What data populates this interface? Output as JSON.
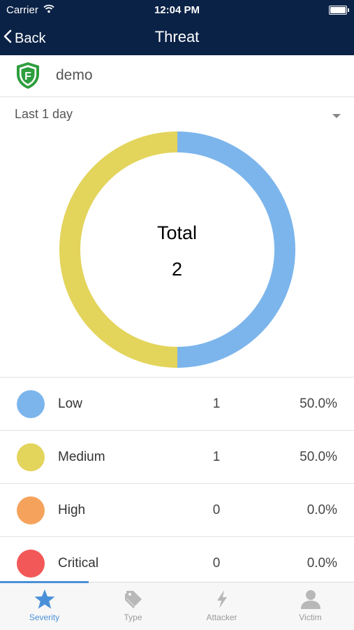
{
  "status": {
    "carrier": "Carrier",
    "time": "12:04 PM"
  },
  "nav": {
    "back_label": "Back",
    "title": "Threat"
  },
  "org": {
    "name": "demo",
    "logo_letter": "F",
    "logo_color": "#2e9e3f"
  },
  "range": {
    "selected": "Last 1 day"
  },
  "chart_data": {
    "type": "pie",
    "title": "",
    "center_label": "Total",
    "total": "2",
    "categories": [
      "Low",
      "Medium",
      "High",
      "Critical"
    ],
    "values": [
      1,
      1,
      0,
      0
    ],
    "colors": [
      "#7cb5ec",
      "#e3d45c",
      "#f5a35c",
      "#f25858"
    ],
    "donut": true
  },
  "legend": {
    "rows": [
      {
        "label": "Low",
        "count": "1",
        "percent": "50.0%",
        "color": "#7cb5ec"
      },
      {
        "label": "Medium",
        "count": "1",
        "percent": "50.0%",
        "color": "#e3d45c"
      },
      {
        "label": "High",
        "count": "0",
        "percent": "0.0%",
        "color": "#f5a35c"
      },
      {
        "label": "Critical",
        "count": "0",
        "percent": "0.0%",
        "color": "#f25858"
      }
    ]
  },
  "tabs": [
    {
      "label": "Severity",
      "icon": "star-icon",
      "active": true
    },
    {
      "label": "Type",
      "icon": "tag-icon",
      "active": false
    },
    {
      "label": "Attacker",
      "icon": "lightning-icon",
      "active": false
    },
    {
      "label": "Victim",
      "icon": "user-icon",
      "active": false
    }
  ],
  "accent_color": "#4a90d9",
  "header_color": "#0a2246"
}
